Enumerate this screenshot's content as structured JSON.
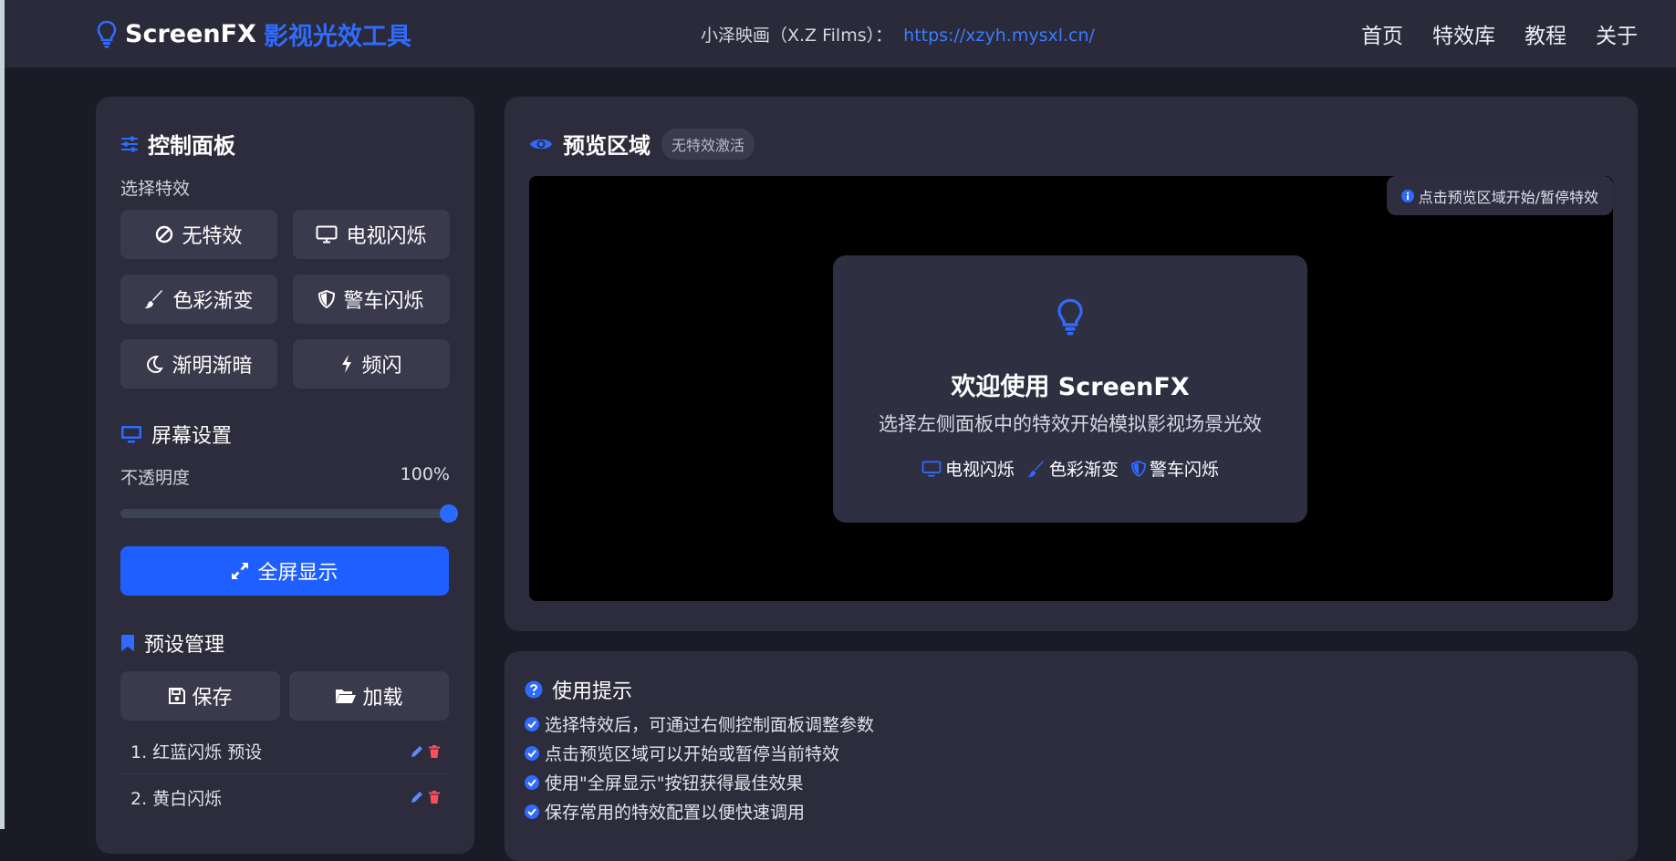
{
  "header": {
    "brand_name": "ScreenFX",
    "brand_sub": "影视光效工具",
    "credit_label": "小泽映画（X.Z Films）：",
    "credit_link": "https://xzyh.mysxl.cn/",
    "nav": [
      "首页",
      "特效库",
      "教程",
      "关于"
    ]
  },
  "control_panel": {
    "title": "控制面板",
    "select_label": "选择特效",
    "effects": [
      {
        "label": "无特效",
        "icon": "ban-icon"
      },
      {
        "label": "电视闪烁",
        "icon": "tv-icon"
      },
      {
        "label": "色彩渐变",
        "icon": "brush-icon"
      },
      {
        "label": "警车闪烁",
        "icon": "shield-icon"
      },
      {
        "label": "渐明渐暗",
        "icon": "moon-icon"
      },
      {
        "label": "频闪",
        "icon": "bolt-icon"
      }
    ],
    "screen_settings": {
      "title": "屏幕设置",
      "opacity_label": "不透明度",
      "opacity_value": "100%",
      "opacity_fraction": 1.0,
      "fullscreen_label": "全屏显示"
    },
    "presets": {
      "title": "预设管理",
      "save_label": "保存",
      "load_label": "加载",
      "items": [
        "1. 红蓝闪烁 预设",
        "2. 黄白闪烁"
      ]
    }
  },
  "preview": {
    "title": "预览区域",
    "badge": "无特效激活",
    "hint": "点击预览区域开始/暂停特效",
    "welcome": {
      "title": "欢迎使用 ScreenFX",
      "subtitle": "选择左侧面板中的特效开始模拟影视场景光效",
      "tags": [
        "电视闪烁",
        "色彩渐变",
        "警车闪烁"
      ]
    }
  },
  "tips": {
    "title": "使用提示",
    "items": [
      "选择特效后，可通过右侧控制面板调整参数",
      "点击预览区域可以开始或暂停当前特效",
      "使用\"全屏显示\"按钮获得最佳效果",
      "保存常用的特效配置以便快速调用"
    ]
  },
  "colors": {
    "accent": "#1f5fff",
    "background": "#1b1b28",
    "panel": "#2c2c3c"
  }
}
